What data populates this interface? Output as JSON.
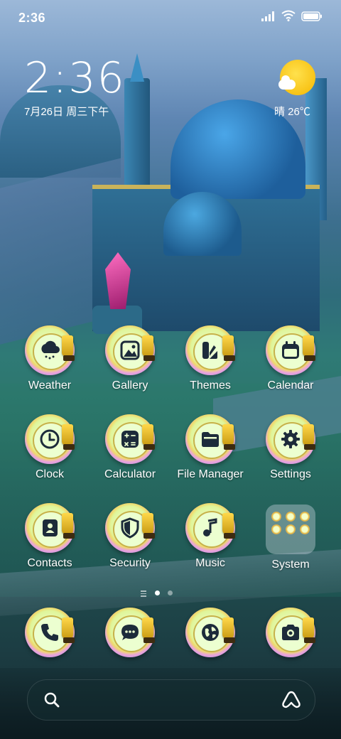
{
  "status_bar": {
    "time": "2:36",
    "battery_level": 1.0
  },
  "clock_widget": {
    "time": "2:36",
    "date": "7月26日 周三下午"
  },
  "weather_widget": {
    "condition_icon": "sun-behind-cloud-icon",
    "text": "晴 26℃"
  },
  "apps": [
    {
      "label": "Weather",
      "icon": "cloud-rain-icon"
    },
    {
      "label": "Gallery",
      "icon": "image-icon"
    },
    {
      "label": "Themes",
      "icon": "brush-palette-icon"
    },
    {
      "label": "Calendar",
      "icon": "calendar-icon"
    },
    {
      "label": "Clock",
      "icon": "clock-icon"
    },
    {
      "label": "Calculator",
      "icon": "calculator-icon"
    },
    {
      "label": "File Manager",
      "icon": "folder-icon"
    },
    {
      "label": "Settings",
      "icon": "gear-icon"
    },
    {
      "label": "Contacts",
      "icon": "contact-book-icon"
    },
    {
      "label": "Security",
      "icon": "shield-icon"
    },
    {
      "label": "Music",
      "icon": "music-note-icon"
    }
  ],
  "folder": {
    "label": "System",
    "items": 6
  },
  "page_indicator": {
    "current_page": 1,
    "pages": 2
  },
  "dock": [
    {
      "icon": "phone-icon"
    },
    {
      "icon": "message-icon"
    },
    {
      "icon": "browser-globe-icon"
    },
    {
      "icon": "camera-icon"
    }
  ],
  "search_bar": {
    "left_icon": "search-icon",
    "right_icon": "assistant-icon"
  },
  "colors": {
    "badge_center": "#ecffd0",
    "trophy_gold": "#ffd84a",
    "glyph_dark": "#1d2b3a"
  }
}
